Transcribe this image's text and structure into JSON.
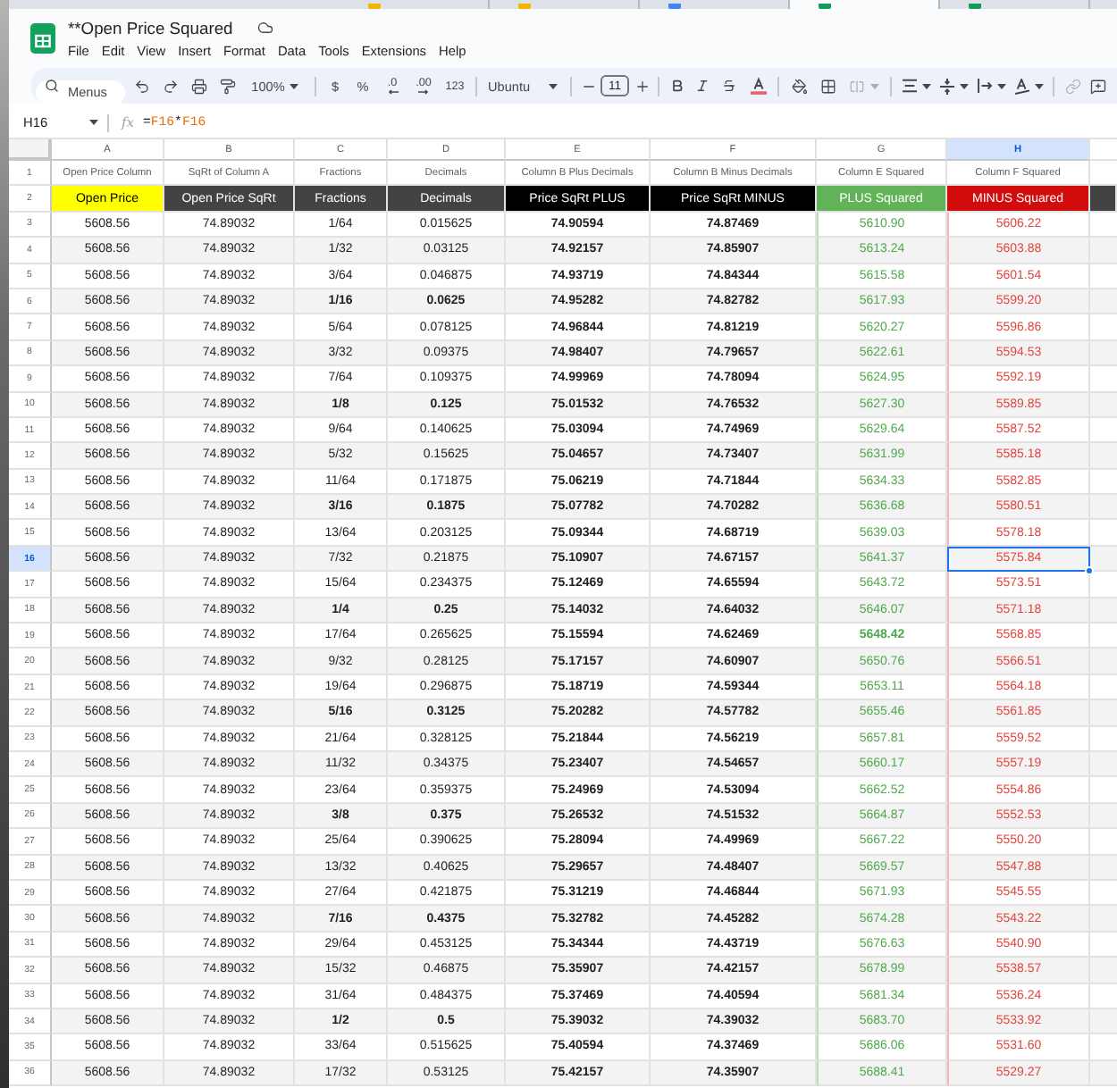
{
  "browser_tabs": [
    {
      "selected": false,
      "color": "#f4b400"
    },
    {
      "selected": false,
      "color": "#f4b400"
    },
    {
      "selected": false,
      "color": "#4285f4"
    },
    {
      "selected": true,
      "color": "#0f9d58"
    },
    {
      "selected": false,
      "color": "#0f9d58"
    }
  ],
  "document": {
    "title": "**Open Price Squared",
    "menu": [
      "File",
      "Edit",
      "View",
      "Insert",
      "Format",
      "Data",
      "Tools",
      "Extensions",
      "Help"
    ]
  },
  "toolbar": {
    "search": {
      "placeholder": "Menus"
    },
    "zoom": "100%",
    "currency": "$",
    "percent": "%",
    "decrease_decimal": ".0",
    "increase_decimal": ".00",
    "number_format": "123",
    "font": "Ubuntu",
    "font_size": "11",
    "merge": {
      "disabled": true
    },
    "link": {
      "disabled": true
    }
  },
  "formula_bar": {
    "cell": "H16",
    "function_label": "fx",
    "formula": [
      {
        "text": "=",
        "kind": "operator"
      },
      {
        "text": "F16",
        "kind": "reference"
      },
      {
        "text": "*",
        "kind": "operator"
      },
      {
        "text": "F16",
        "kind": "reference"
      }
    ]
  },
  "grid": {
    "columns": [
      {
        "label": "A",
        "selected": false,
        "kind": "plain"
      },
      {
        "label": "B",
        "selected": false,
        "kind": "plain"
      },
      {
        "label": "C",
        "selected": false,
        "kind": "plain"
      },
      {
        "label": "D",
        "selected": false,
        "kind": "plain"
      },
      {
        "label": "E",
        "selected": false,
        "kind": "plain"
      },
      {
        "label": "F",
        "selected": false,
        "kind": "plain"
      },
      {
        "label": "G",
        "selected": false,
        "kind": "gain"
      },
      {
        "label": "H",
        "selected": true,
        "kind": "loss"
      }
    ],
    "label_row": {
      "number": "1",
      "selected": false,
      "cells": [
        "Open Price Column",
        "SqRt of Column A",
        "Fractions",
        "Decimals",
        "Column B Plus Decimals",
        "Column B Minus Decimals",
        "Column E Squared",
        "Column F Squared"
      ]
    },
    "header_row": {
      "number": "2",
      "selected": false,
      "cells": [
        {
          "text": "Open Price",
          "kind": "highlight"
        },
        {
          "text": "Open Price SqRt",
          "kind": "dark"
        },
        {
          "text": "Fractions",
          "kind": "dark"
        },
        {
          "text": "Decimals",
          "kind": "dark"
        },
        {
          "text": "Price SqRt PLUS",
          "kind": "black"
        },
        {
          "text": "Price SqRt MINUS",
          "kind": "black"
        },
        {
          "text": "PLUS Squared",
          "kind": "gain"
        },
        {
          "text": "MINUS Squared",
          "kind": "loss"
        },
        {
          "kind": "dark"
        }
      ]
    },
    "rows": [
      {
        "number": "3",
        "selected": false,
        "cells": [
          "5608.56",
          "74.89032",
          "1/64",
          "0.015625",
          "74.90594",
          "74.87469",
          "5610.90",
          "5606.22"
        ],
        "bold": [
          false,
          false,
          false,
          false,
          true,
          true,
          false,
          false
        ]
      },
      {
        "number": "4",
        "selected": false,
        "cells": [
          "5608.56",
          "74.89032",
          "1/32",
          "0.03125",
          "74.92157",
          "74.85907",
          "5613.24",
          "5603.88"
        ],
        "bold": [
          false,
          false,
          false,
          false,
          true,
          true,
          false,
          false
        ]
      },
      {
        "number": "5",
        "selected": false,
        "cells": [
          "5608.56",
          "74.89032",
          "3/64",
          "0.046875",
          "74.93719",
          "74.84344",
          "5615.58",
          "5601.54"
        ],
        "bold": [
          false,
          false,
          false,
          false,
          true,
          true,
          false,
          false
        ]
      },
      {
        "number": "6",
        "selected": false,
        "cells": [
          "5608.56",
          "74.89032",
          "1/16",
          "0.0625",
          "74.95282",
          "74.82782",
          "5617.93",
          "5599.20"
        ],
        "bold": [
          false,
          false,
          true,
          true,
          true,
          true,
          false,
          false
        ]
      },
      {
        "number": "7",
        "selected": false,
        "cells": [
          "5608.56",
          "74.89032",
          "5/64",
          "0.078125",
          "74.96844",
          "74.81219",
          "5620.27",
          "5596.86"
        ],
        "bold": [
          false,
          false,
          false,
          false,
          true,
          true,
          false,
          false
        ]
      },
      {
        "number": "8",
        "selected": false,
        "cells": [
          "5608.56",
          "74.89032",
          "3/32",
          "0.09375",
          "74.98407",
          "74.79657",
          "5622.61",
          "5594.53"
        ],
        "bold": [
          false,
          false,
          false,
          false,
          true,
          true,
          false,
          false
        ]
      },
      {
        "number": "9",
        "selected": false,
        "cells": [
          "5608.56",
          "74.89032",
          "7/64",
          "0.109375",
          "74.99969",
          "74.78094",
          "5624.95",
          "5592.19"
        ],
        "bold": [
          false,
          false,
          false,
          false,
          true,
          true,
          false,
          false
        ]
      },
      {
        "number": "10",
        "selected": false,
        "cells": [
          "5608.56",
          "74.89032",
          "1/8",
          "0.125",
          "75.01532",
          "74.76532",
          "5627.30",
          "5589.85"
        ],
        "bold": [
          false,
          false,
          true,
          true,
          true,
          true,
          false,
          false
        ]
      },
      {
        "number": "11",
        "selected": false,
        "cells": [
          "5608.56",
          "74.89032",
          "9/64",
          "0.140625",
          "75.03094",
          "74.74969",
          "5629.64",
          "5587.52"
        ],
        "bold": [
          false,
          false,
          false,
          false,
          true,
          true,
          false,
          false
        ]
      },
      {
        "number": "12",
        "selected": false,
        "cells": [
          "5608.56",
          "74.89032",
          "5/32",
          "0.15625",
          "75.04657",
          "74.73407",
          "5631.99",
          "5585.18"
        ],
        "bold": [
          false,
          false,
          false,
          false,
          true,
          true,
          false,
          false
        ]
      },
      {
        "number": "13",
        "selected": false,
        "cells": [
          "5608.56",
          "74.89032",
          "11/64",
          "0.171875",
          "75.06219",
          "74.71844",
          "5634.33",
          "5582.85"
        ],
        "bold": [
          false,
          false,
          false,
          false,
          true,
          true,
          false,
          false
        ]
      },
      {
        "number": "14",
        "selected": false,
        "cells": [
          "5608.56",
          "74.89032",
          "3/16",
          "0.1875",
          "75.07782",
          "74.70282",
          "5636.68",
          "5580.51"
        ],
        "bold": [
          false,
          false,
          true,
          true,
          true,
          true,
          false,
          false
        ]
      },
      {
        "number": "15",
        "selected": false,
        "cells": [
          "5608.56",
          "74.89032",
          "13/64",
          "0.203125",
          "75.09344",
          "74.68719",
          "5639.03",
          "5578.18"
        ],
        "bold": [
          false,
          false,
          false,
          false,
          true,
          true,
          false,
          false
        ]
      },
      {
        "number": "16",
        "selected": true,
        "cells": [
          "5608.56",
          "74.89032",
          "7/32",
          "0.21875",
          "75.10907",
          "74.67157",
          "5641.37",
          "5575.84"
        ],
        "bold": [
          false,
          false,
          false,
          false,
          true,
          true,
          false,
          false
        ]
      },
      {
        "number": "17",
        "selected": false,
        "cells": [
          "5608.56",
          "74.89032",
          "15/64",
          "0.234375",
          "75.12469",
          "74.65594",
          "5643.72",
          "5573.51"
        ],
        "bold": [
          false,
          false,
          false,
          false,
          true,
          true,
          false,
          false
        ]
      },
      {
        "number": "18",
        "selected": false,
        "cells": [
          "5608.56",
          "74.89032",
          "1/4",
          "0.25",
          "75.14032",
          "74.64032",
          "5646.07",
          "5571.18"
        ],
        "bold": [
          false,
          false,
          true,
          true,
          true,
          true,
          false,
          false
        ]
      },
      {
        "number": "19",
        "selected": false,
        "cells": [
          "5608.56",
          "74.89032",
          "17/64",
          "0.265625",
          "75.15594",
          "74.62469",
          "5648.42",
          "5568.85"
        ],
        "bold": [
          false,
          false,
          false,
          false,
          true,
          true,
          true,
          false
        ]
      },
      {
        "number": "20",
        "selected": false,
        "cells": [
          "5608.56",
          "74.89032",
          "9/32",
          "0.28125",
          "75.17157",
          "74.60907",
          "5650.76",
          "5566.51"
        ],
        "bold": [
          false,
          false,
          false,
          false,
          true,
          true,
          false,
          false
        ]
      },
      {
        "number": "21",
        "selected": false,
        "cells": [
          "5608.56",
          "74.89032",
          "19/64",
          "0.296875",
          "75.18719",
          "74.59344",
          "5653.11",
          "5564.18"
        ],
        "bold": [
          false,
          false,
          false,
          false,
          true,
          true,
          false,
          false
        ]
      },
      {
        "number": "22",
        "selected": false,
        "cells": [
          "5608.56",
          "74.89032",
          "5/16",
          "0.3125",
          "75.20282",
          "74.57782",
          "5655.46",
          "5561.85"
        ],
        "bold": [
          false,
          false,
          true,
          true,
          true,
          true,
          false,
          false
        ]
      },
      {
        "number": "23",
        "selected": false,
        "cells": [
          "5608.56",
          "74.89032",
          "21/64",
          "0.328125",
          "75.21844",
          "74.56219",
          "5657.81",
          "5559.52"
        ],
        "bold": [
          false,
          false,
          false,
          false,
          true,
          true,
          false,
          false
        ]
      },
      {
        "number": "24",
        "selected": false,
        "cells": [
          "5608.56",
          "74.89032",
          "11/32",
          "0.34375",
          "75.23407",
          "74.54657",
          "5660.17",
          "5557.19"
        ],
        "bold": [
          false,
          false,
          false,
          false,
          true,
          true,
          false,
          false
        ]
      },
      {
        "number": "25",
        "selected": false,
        "cells": [
          "5608.56",
          "74.89032",
          "23/64",
          "0.359375",
          "75.24969",
          "74.53094",
          "5662.52",
          "5554.86"
        ],
        "bold": [
          false,
          false,
          false,
          false,
          true,
          true,
          false,
          false
        ]
      },
      {
        "number": "26",
        "selected": false,
        "cells": [
          "5608.56",
          "74.89032",
          "3/8",
          "0.375",
          "75.26532",
          "74.51532",
          "5664.87",
          "5552.53"
        ],
        "bold": [
          false,
          false,
          true,
          true,
          true,
          true,
          false,
          false
        ]
      },
      {
        "number": "27",
        "selected": false,
        "cells": [
          "5608.56",
          "74.89032",
          "25/64",
          "0.390625",
          "75.28094",
          "74.49969",
          "5667.22",
          "5550.20"
        ],
        "bold": [
          false,
          false,
          false,
          false,
          true,
          true,
          false,
          false
        ]
      },
      {
        "number": "28",
        "selected": false,
        "cells": [
          "5608.56",
          "74.89032",
          "13/32",
          "0.40625",
          "75.29657",
          "74.48407",
          "5669.57",
          "5547.88"
        ],
        "bold": [
          false,
          false,
          false,
          false,
          true,
          true,
          false,
          false
        ]
      },
      {
        "number": "29",
        "selected": false,
        "cells": [
          "5608.56",
          "74.89032",
          "27/64",
          "0.421875",
          "75.31219",
          "74.46844",
          "5671.93",
          "5545.55"
        ],
        "bold": [
          false,
          false,
          false,
          false,
          true,
          true,
          false,
          false
        ]
      },
      {
        "number": "30",
        "selected": false,
        "cells": [
          "5608.56",
          "74.89032",
          "7/16",
          "0.4375",
          "75.32782",
          "74.45282",
          "5674.28",
          "5543.22"
        ],
        "bold": [
          false,
          false,
          true,
          true,
          true,
          true,
          false,
          false
        ]
      },
      {
        "number": "31",
        "selected": false,
        "cells": [
          "5608.56",
          "74.89032",
          "29/64",
          "0.453125",
          "75.34344",
          "74.43719",
          "5676.63",
          "5540.90"
        ],
        "bold": [
          false,
          false,
          false,
          false,
          true,
          true,
          false,
          false
        ]
      },
      {
        "number": "32",
        "selected": false,
        "cells": [
          "5608.56",
          "74.89032",
          "15/32",
          "0.46875",
          "75.35907",
          "74.42157",
          "5678.99",
          "5538.57"
        ],
        "bold": [
          false,
          false,
          false,
          false,
          true,
          true,
          false,
          false
        ]
      },
      {
        "number": "33",
        "selected": false,
        "cells": [
          "5608.56",
          "74.89032",
          "31/64",
          "0.484375",
          "75.37469",
          "74.40594",
          "5681.34",
          "5536.24"
        ],
        "bold": [
          false,
          false,
          false,
          false,
          true,
          true,
          false,
          false
        ]
      },
      {
        "number": "34",
        "selected": false,
        "cells": [
          "5608.56",
          "74.89032",
          "1/2",
          "0.5",
          "75.39032",
          "74.39032",
          "5683.70",
          "5533.92"
        ],
        "bold": [
          false,
          false,
          true,
          true,
          true,
          true,
          false,
          false
        ]
      },
      {
        "number": "35",
        "selected": false,
        "cells": [
          "5608.56",
          "74.89032",
          "33/64",
          "0.515625",
          "75.40594",
          "74.37469",
          "5686.06",
          "5531.60"
        ],
        "bold": [
          false,
          false,
          false,
          false,
          true,
          true,
          false,
          false
        ]
      },
      {
        "number": "36",
        "selected": false,
        "cells": [
          "5608.56",
          "74.89032",
          "17/32",
          "0.53125",
          "75.42157",
          "74.35907",
          "5688.41",
          "5529.27"
        ],
        "bold": [
          false,
          false,
          false,
          false,
          true,
          true,
          false,
          false
        ]
      }
    ]
  }
}
